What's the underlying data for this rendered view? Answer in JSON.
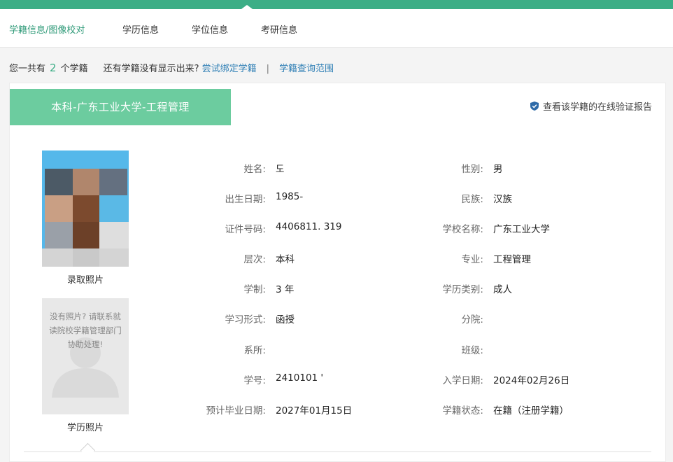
{
  "nav": {
    "tabs": [
      {
        "label": "学籍信息/图像校对"
      },
      {
        "label": "学历信息"
      },
      {
        "label": "学位信息"
      },
      {
        "label": "考研信息"
      }
    ]
  },
  "summary": {
    "prefix": "您一共有",
    "count": "2",
    "suffix": "个学籍",
    "question": "还有学籍没有显示出来?",
    "bind_link": "尝试绑定学籍",
    "separator": "|",
    "scope_link": "学籍查询范围"
  },
  "record": {
    "title": "本科-广东工业大学-工程管理",
    "verify_link": "查看该学籍的在线验证报告",
    "photo1_caption": "录取照片",
    "photo2_caption": "学历照片",
    "photo2_note": "没有照片? 请联系就读院校学籍管理部门协助处理!",
    "left_fields": [
      {
        "label": "姓名:",
        "value": "도"
      },
      {
        "label": "出生日期:",
        "value": "1985-"
      },
      {
        "label": "证件号码:",
        "value": "4406811.              319"
      },
      {
        "label": "层次:",
        "value": "本科"
      },
      {
        "label": "学制:",
        "value": "3 年"
      },
      {
        "label": "学习形式:",
        "value": "函授"
      },
      {
        "label": "系所:",
        "value": ""
      },
      {
        "label": "学号:",
        "value": "2410101               '"
      },
      {
        "label": "预计毕业日期:",
        "value": "2027年01月15日"
      }
    ],
    "right_fields": [
      {
        "label": "性别:",
        "value": "男"
      },
      {
        "label": "民族:",
        "value": "汉族"
      },
      {
        "label": "学校名称:",
        "value": "广东工业大学"
      },
      {
        "label": "专业:",
        "value": "工程管理"
      },
      {
        "label": "学历类别:",
        "value": "成人"
      },
      {
        "label": "分院:",
        "value": ""
      },
      {
        "label": "班级:",
        "value": ""
      },
      {
        "label": "入学日期:",
        "value": "2024年02月26日"
      },
      {
        "label": "学籍状态:",
        "value": "在籍（注册学籍）"
      }
    ]
  },
  "colors": {
    "brand_green": "#3cae86",
    "title_green": "#6ccc9f",
    "link_blue": "#2f7fb5"
  }
}
